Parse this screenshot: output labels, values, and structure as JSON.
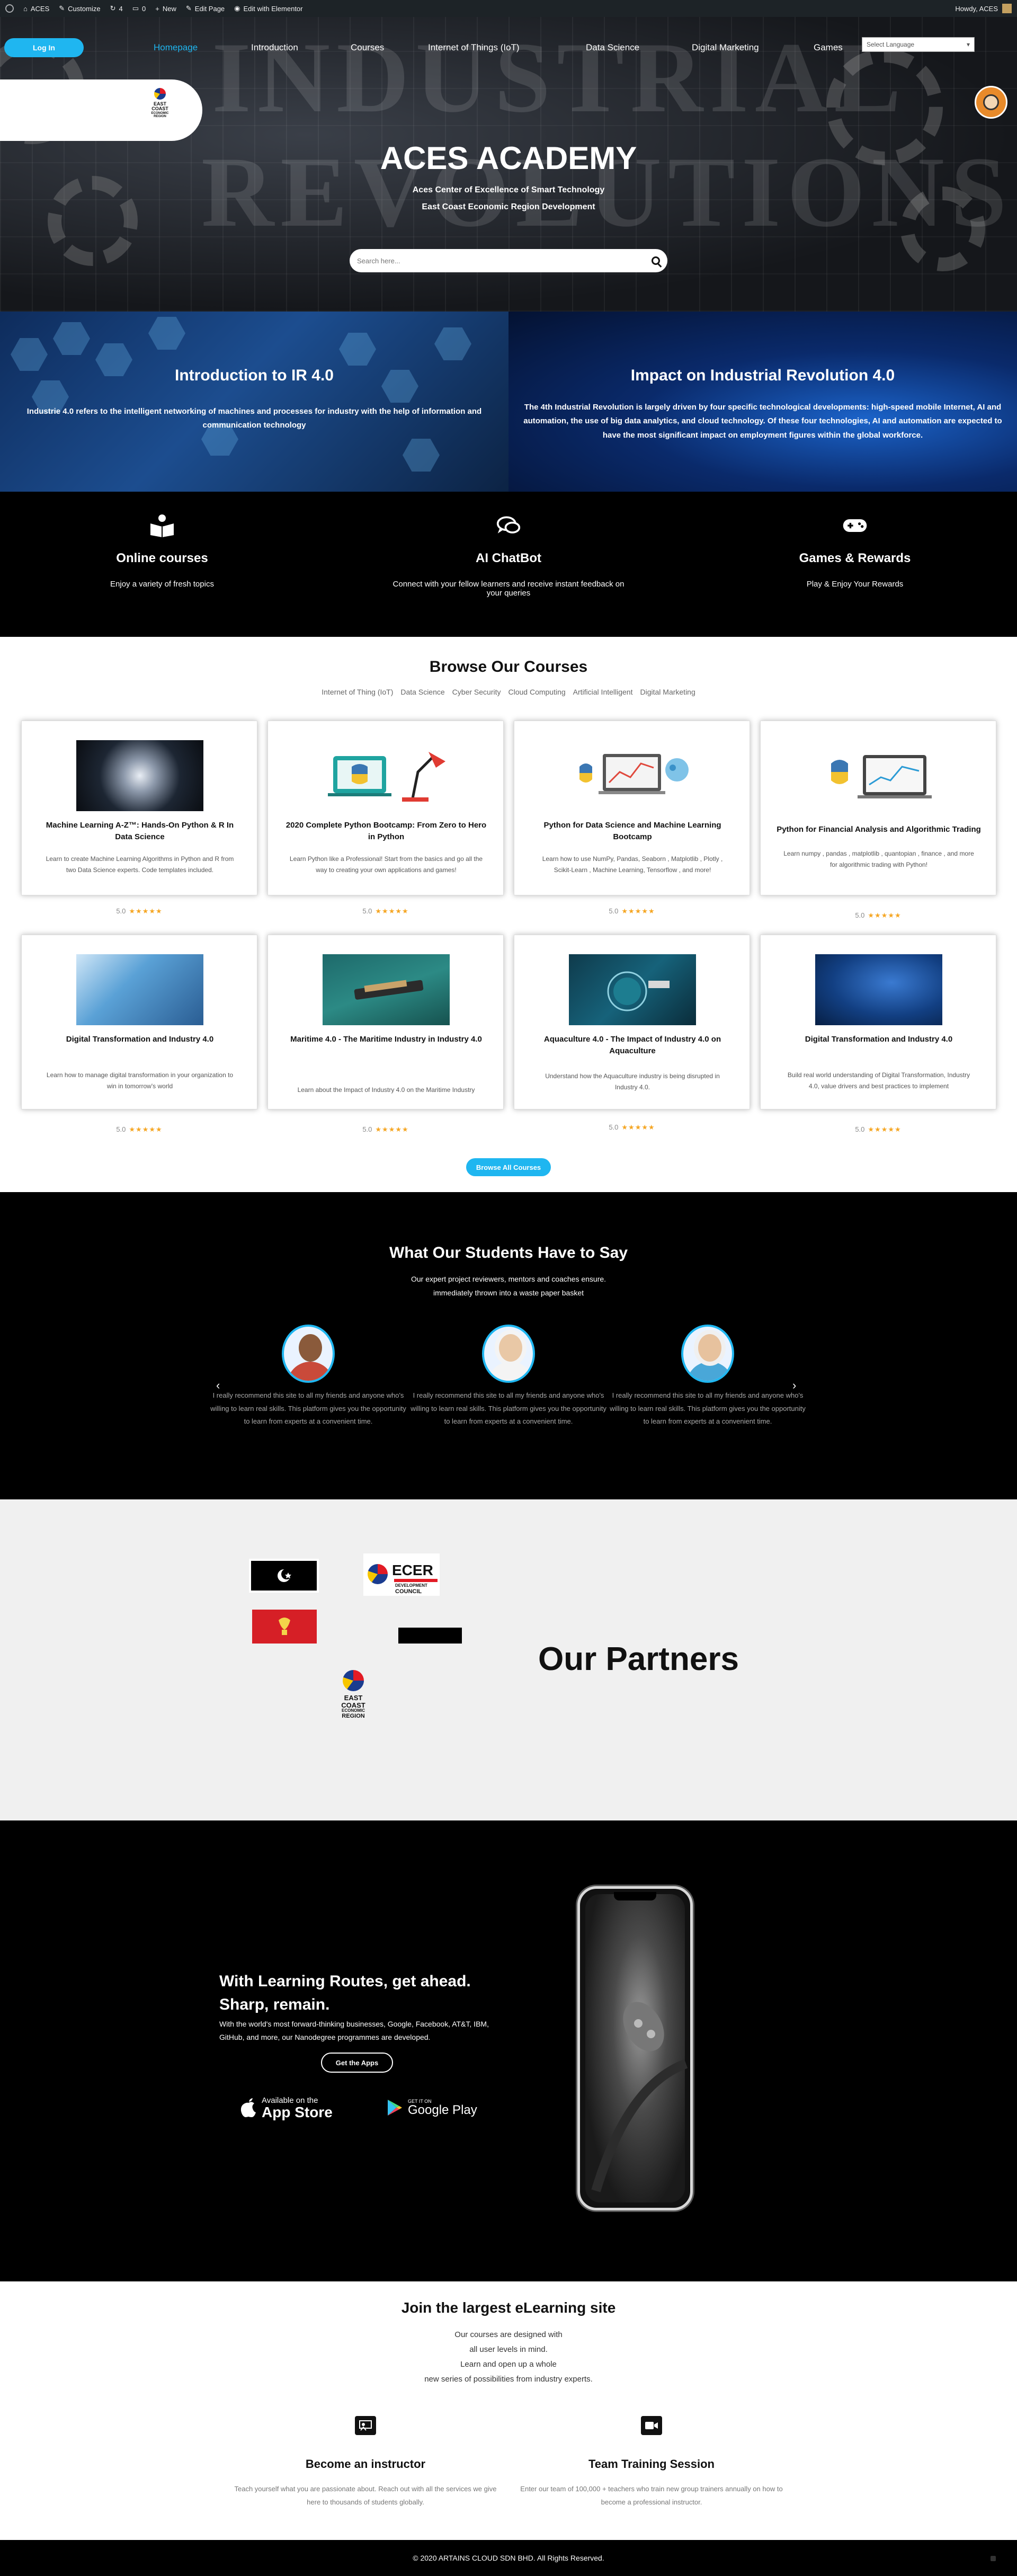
{
  "adminbar": {
    "site": "ACES",
    "customize": "Customize",
    "updates_count": "4",
    "comments_count": "0",
    "new": "New",
    "edit_page": "Edit Page",
    "edit_elementor": "Edit with Elementor",
    "howdy": "Howdy, ACES"
  },
  "header": {
    "login": "Log In",
    "nav": [
      "Homepage",
      "Introduction",
      "Courses",
      "Internet of Things (IoT)",
      "Data Science",
      "Digital Marketing",
      "Games"
    ],
    "language_placeholder": "Select Language",
    "logo_lines": [
      "EAST",
      "COAST",
      "ECONOMIC",
      "REGION"
    ]
  },
  "hero": {
    "bg_word_1": "INDUSTRIAL",
    "bg_word_2": "REVOLUTIONS",
    "title": "ACES ACADEMY",
    "subtitle_1": "Aces Center of Excellence of Smart Technology",
    "subtitle_2": "East Coast Economic Region Development",
    "search_placeholder": "Search here..."
  },
  "intro": {
    "left_title": "Introduction to IR 4.0",
    "left_text": "Industrie 4.0 refers to the intelligent networking of machines and processes for industry with the help of information and communication technology",
    "right_title": "Impact on Industrial Revolution 4.0",
    "right_text": "The 4th Industrial Revolution is largely driven by four specific technological developments: high-speed mobile Internet, AI and automation, the use of big data analytics, and cloud technology. Of these four technologies, AI and automation are expected to have the most significant impact on employment figures within the global workforce."
  },
  "features": [
    {
      "title": "Online courses",
      "text": "Enjoy a variety of fresh topics",
      "icon": "book-icon"
    },
    {
      "title": "AI ChatBot",
      "text": "Connect with your fellow learners and receive instant feedback on your queries",
      "icon": "chat-icon"
    },
    {
      "title": "Games & Rewards",
      "text": "Play & Enjoy Your Rewards",
      "icon": "gamepad-icon"
    }
  ],
  "courses": {
    "heading": "Browse Our Courses",
    "categories": [
      "Internet of Thing (IoT)",
      "Data Science",
      "Cyber Security",
      "Cloud Computing",
      "Artificial Intelligent",
      "Digital Marketing"
    ],
    "cards": [
      {
        "title": "Machine Learning A-Z™: Hands-On Python & R In Data Science",
        "desc": "Learn to create Machine Learning Algorithms in Python and R from two Data Science experts. Code templates included.",
        "rating": "5.0",
        "stars": "★★★★★"
      },
      {
        "title": "2020 Complete Python Bootcamp: From Zero to Hero in Python",
        "desc": "Learn Python like a Professional! Start from the basics and go all the way to creating your own applications and games!",
        "rating": "5.0",
        "stars": "★★★★★"
      },
      {
        "title": "Python for Data Science and Machine Learning Bootcamp",
        "desc": "Learn how to use NumPy, Pandas, Seaborn , Matplotlib , Plotly , Scikit-Learn , Machine Learning, Tensorflow , and more!",
        "rating": "5.0",
        "stars": "★★★★★"
      },
      {
        "title": "Python for Financial Analysis and Algorithmic Trading",
        "desc": "Learn numpy , pandas , matplotlib , quantopian , finance , and more for algorithmic trading with Python!",
        "rating": "5.0",
        "stars": "★★★★★"
      },
      {
        "title": "Digital Transformation and Industry 4.0",
        "desc": "Learn how to manage digital transformation in your organization to win in tomorrow's world",
        "rating": "5.0",
        "stars": "★★★★★"
      },
      {
        "title": "Maritime 4.0 - The Maritime Industry in Industry 4.0",
        "desc": "Learn about the Impact of Industry 4.0 on the Maritime Industry",
        "rating": "5.0",
        "stars": "★★★★★"
      },
      {
        "title": "Aquaculture 4.0 - The Impact of Industry 4.0 on Aquaculture",
        "desc": "Understand how the Aquaculture industry is being disrupted in Industry 4.0.",
        "rating": "5.0",
        "stars": "★★★★★"
      },
      {
        "title": "Digital Transformation and Industry 4.0",
        "desc": "Build real world understanding of Digital Transformation, Industry 4.0, value drivers and best practices to implement",
        "rating": "5.0",
        "stars": "★★★★★"
      }
    ],
    "browse_all": "Browse All Courses"
  },
  "testimonials": {
    "heading": "What Our Students Have to Say",
    "lead_1": "Our expert project reviewers, mentors and coaches ensure.",
    "lead_2": "immediately thrown into a waste paper basket",
    "quote": "I really recommend this site to all my friends and anyone who's willing to learn real skills. This platform gives you the opportunity to learn from experts at a convenient time.",
    "prev": "‹",
    "next": "›"
  },
  "partners": {
    "heading": "Our Partners",
    "ecer_title": "ECER",
    "ecer_sub_1": "DEVELOPMENT",
    "ecer_sub_2": "COUNCIL",
    "ecer_logo_lines": [
      "EAST",
      "COAST",
      "ECONOMIC",
      "REGION"
    ]
  },
  "app": {
    "heading_1": "With Learning Routes, get ahead.",
    "heading_2": "Sharp, remain.",
    "text": "With the world's most forward-thinking businesses, Google, Facebook, AT&T, IBM, GitHub, and more, our Nanodegree programmes are developed.",
    "button": "Get the Apps",
    "appstore_small": "Available on the",
    "appstore_big": "App Store",
    "play_small": "GET IT ON",
    "play_big": "Google Play"
  },
  "join": {
    "heading": "Join the largest eLearning site",
    "lines": [
      "Our courses are designed with",
      "all user levels in mind.",
      "Learn and open up a whole",
      "new series of possibilities from industry experts."
    ],
    "cols": [
      {
        "title": "Become an instructor",
        "text": "Teach yourself what you are passionate about. Reach out with all the services we give here to thousands of students globally."
      },
      {
        "title": "Team Training Session",
        "text": "Enter our team of 100,000 + teachers who train new group trainers annually on how to become a professional instructor."
      }
    ]
  },
  "footer": {
    "copyright": "© 2020 ARTAINS CLOUD SDN BHD. All Rights Reserved."
  }
}
